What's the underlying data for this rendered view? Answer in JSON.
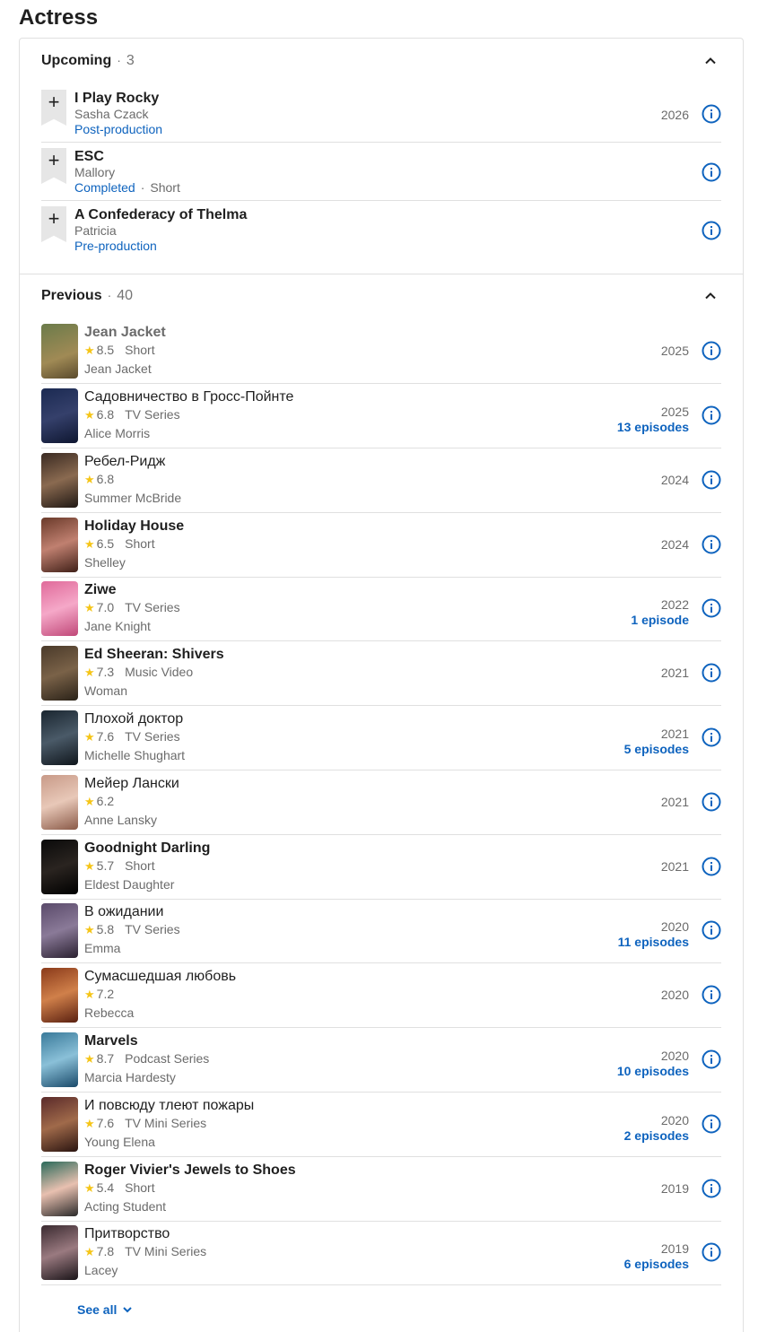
{
  "page_title": "Actress",
  "colors": {
    "link": "#0e63be",
    "star": "#f5c518",
    "muted": "#6b6b6b",
    "divider": "#e0e0e0"
  },
  "upcoming": {
    "label": "Upcoming",
    "count": "3",
    "items": [
      {
        "title": "I Play Rocky",
        "role": "Sasha Czack",
        "status": "Post-production",
        "kind": "",
        "year": "2026"
      },
      {
        "title": "ESC",
        "role": "Mallory",
        "status": "Completed",
        "kind": "Short",
        "year": ""
      },
      {
        "title": "A Confederacy of Thelma",
        "role": "Patricia",
        "status": "Pre-production",
        "kind": "",
        "year": ""
      }
    ]
  },
  "previous": {
    "label": "Previous",
    "count": "40",
    "items": [
      {
        "title": "Jean Jacket",
        "rating": "8.5",
        "kind": "Short",
        "role": "Jean Jacket",
        "year": "2025",
        "episodes": ""
      },
      {
        "title": "Садовничество в Гросс-Пойнте",
        "rating": "6.8",
        "kind": "TV Series",
        "role": "Alice Morris",
        "year": "2025",
        "episodes": "13 episodes"
      },
      {
        "title": "Ребел-Ридж",
        "rating": "6.8",
        "kind": "",
        "role": "Summer McBride",
        "year": "2024",
        "episodes": ""
      },
      {
        "title": "Holiday House",
        "rating": "6.5",
        "kind": "Short",
        "role": "Shelley",
        "year": "2024",
        "episodes": ""
      },
      {
        "title": "Ziwe",
        "rating": "7.0",
        "kind": "TV Series",
        "role": "Jane Knight",
        "year": "2022",
        "episodes": "1 episode"
      },
      {
        "title": "Ed Sheeran: Shivers",
        "rating": "7.3",
        "kind": "Music Video",
        "role": "Woman",
        "year": "2021",
        "episodes": ""
      },
      {
        "title": "Плохой доктор",
        "rating": "7.6",
        "kind": "TV Series",
        "role": "Michelle Shughart",
        "year": "2021",
        "episodes": "5 episodes"
      },
      {
        "title": "Мейер Лански",
        "rating": "6.2",
        "kind": "",
        "role": "Anne Lansky",
        "year": "2021",
        "episodes": ""
      },
      {
        "title": "Goodnight Darling",
        "rating": "5.7",
        "kind": "Short",
        "role": "Eldest Daughter",
        "year": "2021",
        "episodes": ""
      },
      {
        "title": "В ожидании",
        "rating": "5.8",
        "kind": "TV Series",
        "role": "Emma",
        "year": "2020",
        "episodes": "11 episodes"
      },
      {
        "title": "Сумасшедшая любовь",
        "rating": "7.2",
        "kind": "",
        "role": "Rebecca",
        "year": "2020",
        "episodes": ""
      },
      {
        "title": "Marvels",
        "rating": "8.7",
        "kind": "Podcast Series",
        "role": "Marcia Hardesty",
        "year": "2020",
        "episodes": "10 episodes"
      },
      {
        "title": "И повсюду тлеют пожары",
        "rating": "7.6",
        "kind": "TV Mini Series",
        "role": "Young Elena",
        "year": "2020",
        "episodes": "2 episodes"
      },
      {
        "title": "Roger Vivier's Jewels to Shoes",
        "rating": "5.4",
        "kind": "Short",
        "role": "Acting Student",
        "year": "2019",
        "episodes": ""
      },
      {
        "title": "Притворство",
        "rating": "7.8",
        "kind": "TV Mini Series",
        "role": "Lacey",
        "year": "2019",
        "episodes": "6 episodes"
      }
    ]
  },
  "see_all_label": "See all"
}
